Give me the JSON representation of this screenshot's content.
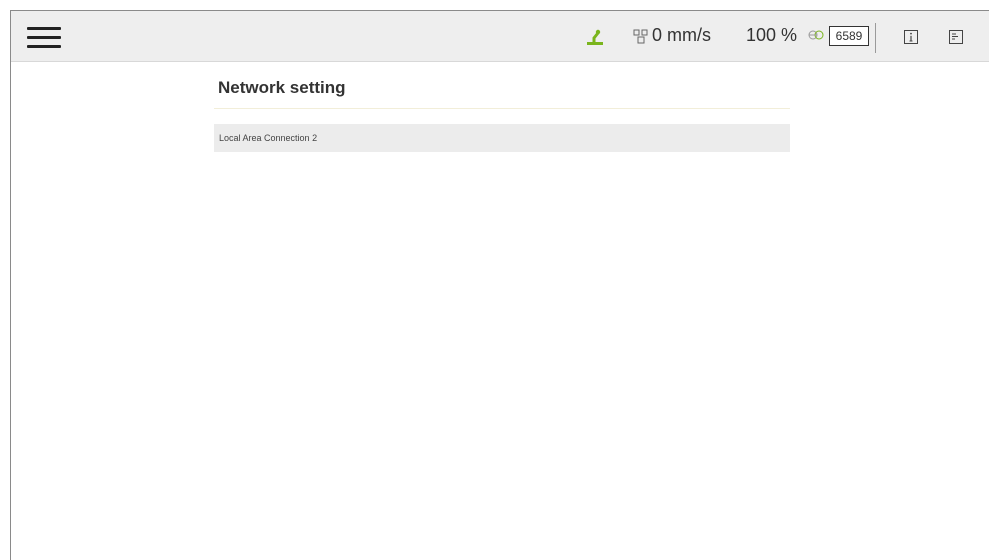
{
  "topbar": {
    "menu_icon": "hamburger-menu-icon",
    "robot_status_icon": "robot-arm-icon",
    "robot_status_color": "#7ab51d",
    "speed_icon": "speed-icon",
    "speed": "0 mm/s",
    "speed_percent": "100 %",
    "network_icon": "globe-icon",
    "counter": "6589",
    "info_icon": "info-icon",
    "log_icon": "log-icon"
  },
  "page": {
    "title": "Network setting"
  },
  "network_list": {
    "items": [
      {
        "label": "Local Area Connection 2"
      }
    ]
  }
}
